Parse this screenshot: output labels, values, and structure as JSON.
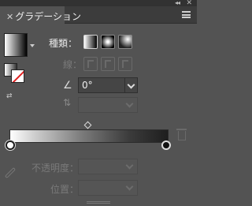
{
  "window": {
    "collapse_glyph": "◂◂",
    "close_glyph": "✕"
  },
  "panel": {
    "tab_close": "✕",
    "tab_label": "グラデーション"
  },
  "labels": {
    "type": "種類：",
    "stroke": "線：",
    "angle_icon": "∠",
    "aspect_icon": "⇅",
    "opacity": "不透明度：",
    "location": "位置："
  },
  "angle": {
    "value": "0°"
  },
  "gradient": {
    "type": "linear",
    "stops": [
      {
        "location": 0,
        "color": "#ffffff"
      },
      {
        "location": 100,
        "color": "#1e1e1e"
      }
    ],
    "midpoint": 50
  },
  "icons": {
    "swap": "⇄",
    "collapse": "collapse-icon",
    "close": "close-icon",
    "menu": "menu-icon",
    "trash": "trash-icon",
    "eyedropper": "eyedropper-icon"
  },
  "colors": {
    "panel_bg": "#535353",
    "tabbar_bg": "#3c3c3c",
    "stroke_none_slash": "#e02020"
  }
}
